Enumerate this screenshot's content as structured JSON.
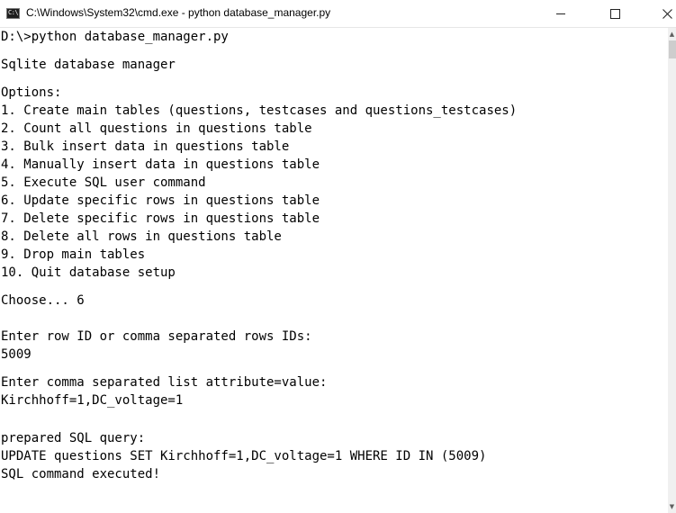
{
  "window": {
    "title": "C:\\Windows\\System32\\cmd.exe - python  database_manager.py",
    "app_icon_text": "C:\\",
    "icons": {
      "app": "console-icon",
      "minimize": "minimize-icon",
      "maximize": "maximize-icon",
      "close": "close-icon"
    }
  },
  "console": {
    "lines": [
      "D:\\>python database_manager.py",
      "Sqlite database manager",
      "Options:",
      "1. Create main tables (questions, testcases and questions_testcases)",
      "2. Count all questions in questions table",
      "3. Bulk insert data in questions table",
      "4. Manually insert data in questions table",
      "5. Execute SQL user command",
      "6. Update specific rows in questions table",
      "7. Delete specific rows in questions table",
      "8. Delete all rows in questions table",
      "9. Drop main tables",
      "10. Quit database setup",
      "Choose... 6",
      "Enter row ID or comma separated rows IDs:",
      "5009",
      "Enter comma separated list attribute=value:",
      "Kirchhoff=1,DC_voltage=1",
      "prepared SQL query:",
      "UPDATE questions SET Kirchhoff=1,DC_voltage=1 WHERE ID IN (5009)",
      "SQL command executed!"
    ]
  },
  "scrollbar": {
    "up_arrow": "▲",
    "down_arrow": "▼"
  },
  "colors": {
    "background": "#ffffff",
    "text": "#000000",
    "titlebar": "#ffffff",
    "scrollbar_track": "#f0f0f0",
    "scrollbar_thumb": "#cdcdcd"
  }
}
